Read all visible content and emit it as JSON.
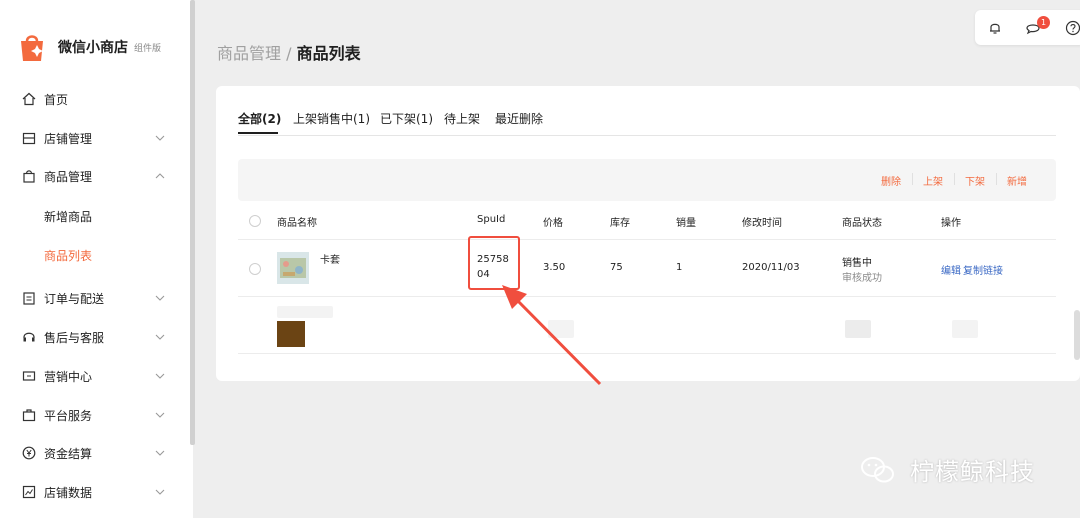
{
  "brand": {
    "name": "微信小商店",
    "edition": "组件版"
  },
  "sidebar": {
    "items": [
      {
        "label": "首页",
        "icon": "home-icon"
      },
      {
        "label": "店铺管理",
        "icon": "store-icon"
      },
      {
        "label": "商品管理",
        "icon": "bag-icon"
      },
      {
        "label": "订单与配送",
        "icon": "clipboard-icon"
      },
      {
        "label": "售后与客服",
        "icon": "headset-icon"
      },
      {
        "label": "营销中心",
        "icon": "ticket-icon"
      },
      {
        "label": "平台服务",
        "icon": "briefcase-icon"
      },
      {
        "label": "资金结算",
        "icon": "yen-coin-icon"
      },
      {
        "label": "店铺数据",
        "icon": "chart-icon"
      }
    ],
    "sub_items": [
      {
        "label": "新增商品"
      },
      {
        "label": "商品列表",
        "active": true
      }
    ]
  },
  "header": {
    "notification_count": "1"
  },
  "breadcrumb": {
    "parent": "商品管理",
    "separator": "/",
    "current": "商品列表"
  },
  "tabs": [
    {
      "label": "全部(2)",
      "active": true
    },
    {
      "label": "上架销售中(1)"
    },
    {
      "label": "已下架(1)"
    },
    {
      "label": "待上架"
    },
    {
      "label": "最近删除"
    }
  ],
  "toolbar": {
    "delete": "删除",
    "list": "上架",
    "delist": "下架",
    "add": "新增"
  },
  "table": {
    "headers": [
      "商品名称",
      "SpuId",
      "价格",
      "库存",
      "销量",
      "修改时间",
      "商品状态",
      "操作"
    ],
    "rows": [
      {
        "name": "卡套",
        "spuid_line1": "25758",
        "spuid_line2": "04",
        "price": "3.50",
        "stock": "75",
        "sales": "1",
        "modified": "2020/11/03",
        "status": "销售中",
        "audit": "审核成功",
        "edit": "编辑",
        "copy_link": "复制链接"
      }
    ]
  },
  "watermark": {
    "text": "柠檬鲸科技"
  },
  "colors": {
    "accent": "#f36a3e",
    "highlight": "#f04e3e",
    "link": "#3a68c4"
  }
}
